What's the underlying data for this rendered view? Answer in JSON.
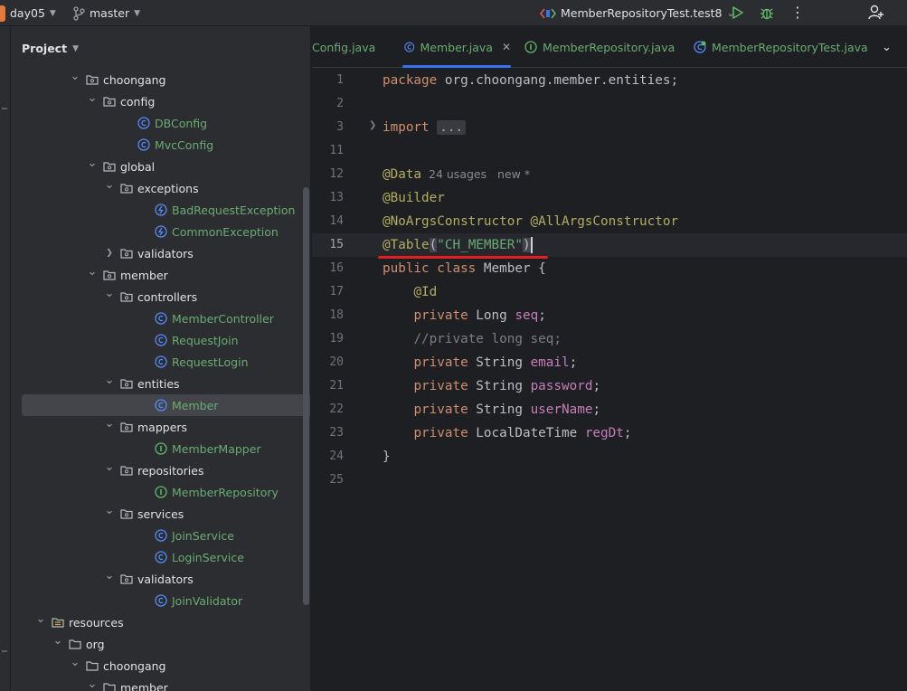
{
  "toolbar": {
    "project": "day05",
    "branch": "master",
    "run_config": "MemberRepositoryTest.test8"
  },
  "project_panel": {
    "title": "Project",
    "tree": [
      {
        "label": "choongang",
        "kind": "package",
        "indent": 5,
        "expanded": true
      },
      {
        "label": "config",
        "kind": "package",
        "indent": 6,
        "expanded": true
      },
      {
        "label": "DBConfig",
        "kind": "class",
        "indent": 8
      },
      {
        "label": "MvcConfig",
        "kind": "class",
        "indent": 8
      },
      {
        "label": "global",
        "kind": "package",
        "indent": 6,
        "expanded": true
      },
      {
        "label": "exceptions",
        "kind": "package",
        "indent": 7,
        "expanded": true
      },
      {
        "label": "BadRequestException",
        "kind": "exception",
        "indent": 9
      },
      {
        "label": "CommonException",
        "kind": "exception",
        "indent": 9
      },
      {
        "label": "validators",
        "kind": "package",
        "indent": 7,
        "expanded": false
      },
      {
        "label": "member",
        "kind": "package",
        "indent": 6,
        "expanded": true
      },
      {
        "label": "controllers",
        "kind": "package",
        "indent": 7,
        "expanded": true
      },
      {
        "label": "MemberController",
        "kind": "class",
        "indent": 9
      },
      {
        "label": "RequestJoin",
        "kind": "class",
        "indent": 9
      },
      {
        "label": "RequestLogin",
        "kind": "class",
        "indent": 9
      },
      {
        "label": "entities",
        "kind": "package",
        "indent": 7,
        "expanded": true
      },
      {
        "label": "Member",
        "kind": "class",
        "indent": 9,
        "selected": true
      },
      {
        "label": "mappers",
        "kind": "package",
        "indent": 7,
        "expanded": true
      },
      {
        "label": "MemberMapper",
        "kind": "interface",
        "indent": 9
      },
      {
        "label": "repositories",
        "kind": "package",
        "indent": 7,
        "expanded": true
      },
      {
        "label": "MemberRepository",
        "kind": "interface",
        "indent": 9
      },
      {
        "label": "services",
        "kind": "package",
        "indent": 7,
        "expanded": true
      },
      {
        "label": "JoinService",
        "kind": "class",
        "indent": 9
      },
      {
        "label": "LoginService",
        "kind": "class",
        "indent": 9
      },
      {
        "label": "validators",
        "kind": "package",
        "indent": 7,
        "expanded": true
      },
      {
        "label": "JoinValidator",
        "kind": "class",
        "indent": 9
      },
      {
        "label": "resources",
        "kind": "resources",
        "indent": 3,
        "expanded": true
      },
      {
        "label": "org",
        "kind": "folder",
        "indent": 4,
        "expanded": true
      },
      {
        "label": "choongang",
        "kind": "folder",
        "indent": 5,
        "expanded": true
      },
      {
        "label": "member",
        "kind": "folder",
        "indent": 6,
        "expanded": true
      }
    ]
  },
  "tabs": [
    {
      "label": "Config.java",
      "icon": "class-icon",
      "active": false
    },
    {
      "label": "Member.java",
      "icon": "class-icon",
      "active": true
    },
    {
      "label": "MemberRepository.java",
      "icon": "interface-icon",
      "active": false
    },
    {
      "label": "MemberRepositoryTest.java",
      "icon": "test-class-icon",
      "active": false
    }
  ],
  "editor": {
    "current_line": "15",
    "lines": [
      {
        "n": "1"
      },
      {
        "n": "2"
      },
      {
        "n": "3"
      },
      {
        "n": "11"
      },
      {
        "n": "12"
      },
      {
        "n": "13"
      },
      {
        "n": "14"
      },
      {
        "n": "15"
      },
      {
        "n": "16"
      },
      {
        "n": "17"
      },
      {
        "n": "18"
      },
      {
        "n": "19"
      },
      {
        "n": "20"
      },
      {
        "n": "21"
      },
      {
        "n": "22"
      },
      {
        "n": "23"
      },
      {
        "n": "24"
      },
      {
        "n": "25"
      }
    ],
    "code": {
      "l1_kw": "package",
      "l1_rest": " org.choongang.member.entities;",
      "l3_kw": "import",
      "l3_fold": "...",
      "l12_ann": "@Data",
      "l12_usages": "24 usages",
      "l12_new": "new *",
      "l13_ann": "@Builder",
      "l14_ann1": "@NoArgsConstructor",
      "l14_ann2": "@AllArgsConstructor",
      "l15_ann": "@Table",
      "l15_open": "(",
      "l15_str": "\"CH_MEMBER\"",
      "l15_close": ")",
      "l16_kw": "public class",
      "l16_rest": " Member {",
      "l17_ann": "@Id",
      "l18_kw": "private",
      "l18_type": " Long ",
      "l18_fld": "seq",
      "l19_cmt": "//private long seq;",
      "l20_kw": "private",
      "l20_type": " String ",
      "l20_fld": "email",
      "l21_kw": "private",
      "l21_type": " String ",
      "l21_fld": "password",
      "l22_kw": "private",
      "l22_type": " String ",
      "l22_fld": "userName",
      "l23_kw": "private",
      "l23_type": " LocalDateTime ",
      "l23_fld": "regDt",
      "semicolon": ";",
      "l24_close": "}"
    }
  }
}
